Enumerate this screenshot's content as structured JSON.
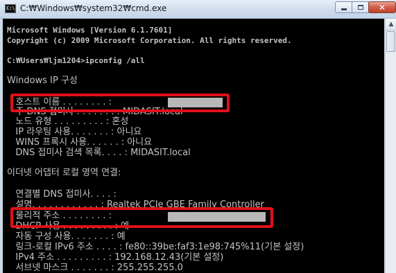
{
  "window": {
    "title": "C:₩Windows₩system32₩cmd.exe",
    "icon_name": "cmd-icon",
    "icon_text": "C:\\",
    "controls": {
      "minimize_icon": "minimize-icon",
      "maximize_icon": "maximize-icon",
      "close_icon": "close-icon",
      "close_glyph": "✕"
    }
  },
  "console": {
    "lines": [
      "Microsoft Windows [Version 6.1.7601]",
      "Copyright (c) 2009 Microsoft Corporation. All rights reserved.",
      "C:₩Users₩ljm1204>ipconfig /all",
      "Windows IP 구성",
      "   호스트 이름 . . . . . . . . :",
      "   주 DNS 접미사 . . . . . . . : MIDASIT.local",
      "   노드 유형 . . . . . . . . . : 혼성",
      "   IP 라우팅 사용. . . . . . . : 아니요",
      "   WINS 프록시 사용. . . . . . : 아니요",
      "   DNS 접미사 검색 목록. . . . : MIDASIT.local",
      "이더넷 어댑터 로컬 영역 연결:",
      "   연결별 DNS 접미사. . . . :",
      "   설명. . . . . . . . . . . . : Realtek PCIe GBE Family Controller",
      "   물리적 주소 . . . . . . . . :",
      "   DHCP 사용 . . . . . . . . . : 예",
      "   자동 구성 사용. . . . . . . : 예",
      "   링크-로컬 IPv6 주소 . . . . : fe80::39be:faf3:1e98:745%11(기본 설정)",
      "   IPv4 주소 . . . . . . . . . : 192.168.12.43(기본 설정)",
      "   서브넷 마스크 . . . . . . . : 255.255.255.0"
    ]
  },
  "colors": {
    "console_bg": "#000000",
    "console_text": "#c4c4c4",
    "highlight_border": "#e0101a",
    "redaction": "#b8b8b8"
  },
  "scrollbar": {
    "up_arrow": "▲"
  }
}
